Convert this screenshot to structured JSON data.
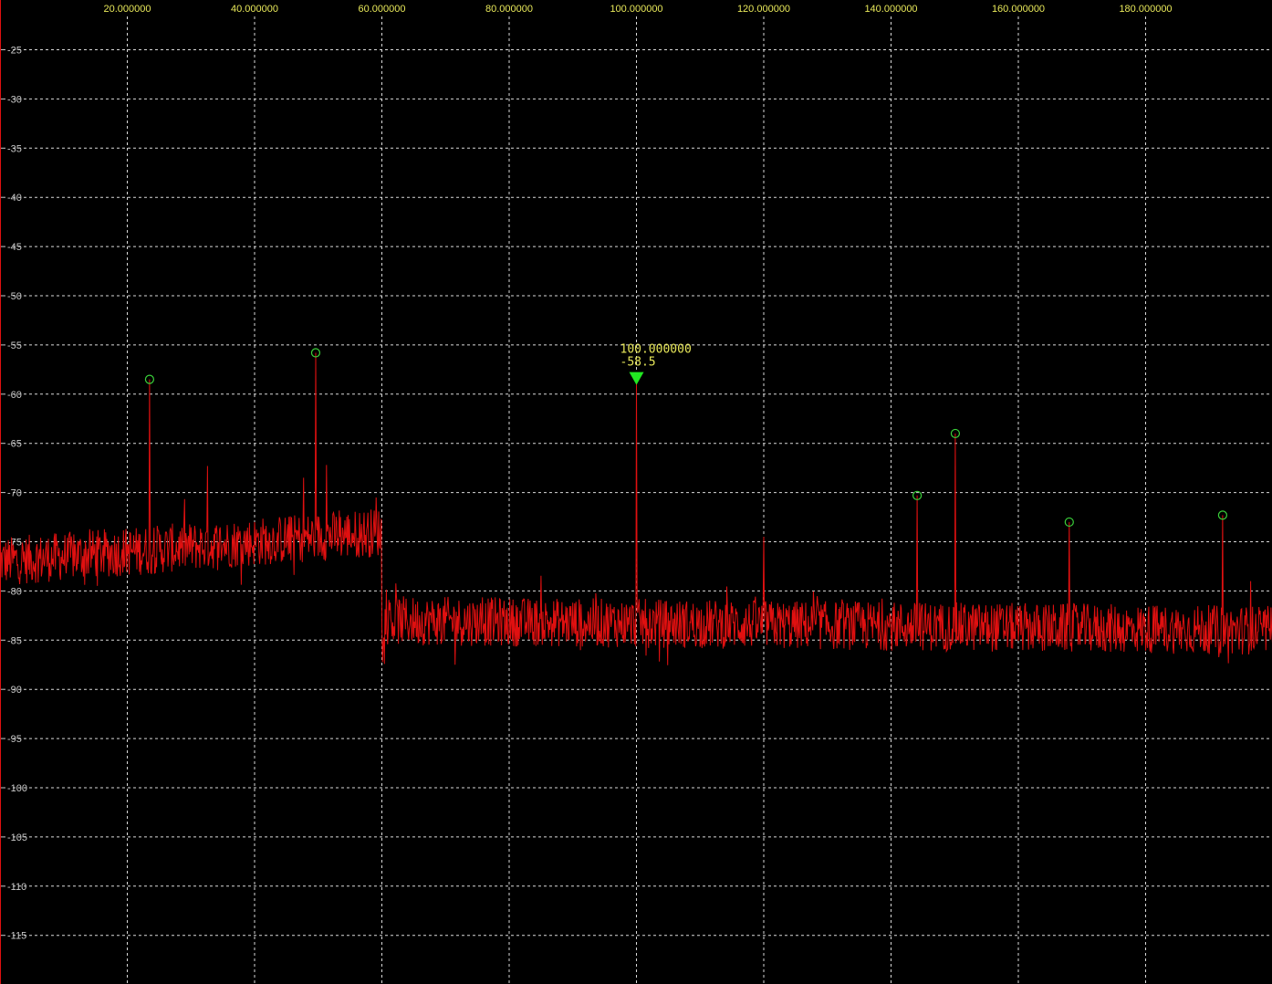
{
  "chart_data": {
    "type": "line",
    "x_ticks": [
      20,
      40,
      60,
      80,
      100,
      120,
      140,
      160,
      180
    ],
    "x_tick_labels": [
      "20.000000",
      "40.000000",
      "60.000000",
      "80.000000",
      "100.000000",
      "120.000000",
      "140.000000",
      "160.000000",
      "180.000000"
    ],
    "y_ticks": [
      -25,
      -30,
      -35,
      -40,
      -45,
      -50,
      -55,
      -60,
      -65,
      -70,
      -75,
      -80,
      -85,
      -90,
      -95,
      -100,
      -105,
      -110,
      -115
    ],
    "y_tick_labels": [
      "-25",
      "-30",
      "-35",
      "-40",
      "-45",
      "-50",
      "-55",
      "-60",
      "-65",
      "-70",
      "-75",
      "-80",
      "-85",
      "-90",
      "-95",
      "-100",
      "-105",
      "-110",
      "-115"
    ],
    "xlim": [
      0,
      200
    ],
    "ylim": [
      -120,
      -20
    ],
    "grid": true,
    "colors": {
      "background": "#000000",
      "trace": "#e01010",
      "grid": "#ffffff",
      "x_tick_text": "#e8e85a",
      "y_tick_text": "#c8c8c8",
      "peak_circle": "#3ad13a",
      "marker": "#22e822",
      "marker_text": "#e8e85a"
    },
    "noise_floor": [
      {
        "x_start": 0,
        "x_end": 60,
        "level_start": -77,
        "level_end": -74
      },
      {
        "x_start": 60,
        "x_end": 200,
        "level_start": -83,
        "level_end": -84
      }
    ],
    "peaks": [
      {
        "x": 23.5,
        "y": -58.5,
        "circled": true
      },
      {
        "x": 32.6,
        "y": -67.3,
        "circled": false
      },
      {
        "x": 47.7,
        "y": -68.5,
        "circled": false
      },
      {
        "x": 49.6,
        "y": -55.8,
        "circled": true
      },
      {
        "x": 51.3,
        "y": -67.2,
        "circled": false
      },
      {
        "x": 59.1,
        "y": -70.5,
        "circled": false
      },
      {
        "x": 100.0,
        "y": -58.5,
        "circled": false
      },
      {
        "x": 120.0,
        "y": -74.5,
        "circled": false
      },
      {
        "x": 144.1,
        "y": -70.3,
        "circled": true
      },
      {
        "x": 150.1,
        "y": -64.0,
        "circled": true
      },
      {
        "x": 168.0,
        "y": -73.0,
        "circled": true
      },
      {
        "x": 192.1,
        "y": -72.3,
        "circled": true
      },
      {
        "x": 196.5,
        "y": -79.0,
        "circled": false
      }
    ],
    "marker": {
      "x": 100.0,
      "y": -58.5,
      "label_x": "100.000000",
      "label_y": "-58.5",
      "symbol": "triangle-down"
    }
  }
}
